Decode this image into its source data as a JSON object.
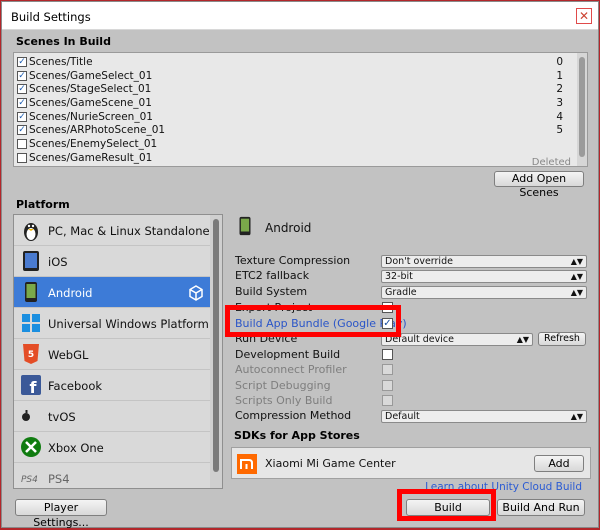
{
  "window": {
    "title": "Build Settings",
    "close_glyph": "✕"
  },
  "scenes": {
    "header": "Scenes In Build",
    "items": [
      {
        "name": "Scenes/Title",
        "checked": true,
        "index": "0"
      },
      {
        "name": "Scenes/GameSelect_01",
        "checked": true,
        "index": "1"
      },
      {
        "name": "Scenes/StageSelect_01",
        "checked": true,
        "index": "2"
      },
      {
        "name": "Scenes/GameScene_01",
        "checked": true,
        "index": "3"
      },
      {
        "name": "Scenes/NurieScreen_01",
        "checked": true,
        "index": "4"
      },
      {
        "name": "Scenes/ARPhotoScene_01",
        "checked": true,
        "index": "5"
      },
      {
        "name": "Scenes/EnemySelect_01",
        "checked": false,
        "index": ""
      },
      {
        "name": "Scenes/GameResult_01",
        "checked": false,
        "index": ""
      }
    ],
    "deleted_label": "Deleted",
    "add_open_scenes": "Add Open Scenes"
  },
  "platform": {
    "header": "Platform",
    "items": [
      {
        "label": "PC, Mac & Linux Standalone",
        "icon": "penguin-icon"
      },
      {
        "label": "iOS",
        "icon": "ios-device-icon"
      },
      {
        "label": "Android",
        "icon": "android-icon",
        "selected": true
      },
      {
        "label": "Universal Windows Platform",
        "icon": "windows-icon"
      },
      {
        "label": "WebGL",
        "icon": "html5-icon"
      },
      {
        "label": "Facebook",
        "icon": "facebook-icon"
      },
      {
        "label": "tvOS",
        "icon": "appletv-icon"
      },
      {
        "label": "Xbox One",
        "icon": "xbox-icon"
      },
      {
        "label": "PS4",
        "icon": "ps4-icon"
      }
    ]
  },
  "settings": {
    "platform_title": "Android",
    "texture_compression": {
      "label": "Texture Compression",
      "value": "Don't override"
    },
    "etc2_fallback": {
      "label": "ETC2 fallback",
      "value": "32-bit"
    },
    "build_system": {
      "label": "Build System",
      "value": "Gradle"
    },
    "export_project": {
      "label": "Export Project",
      "checked": false
    },
    "build_app_bundle": {
      "label": "Build App Bundle (Google Play)",
      "checked": true
    },
    "run_device": {
      "label": "Run Device",
      "value": "Default device",
      "refresh": "Refresh"
    },
    "development_build": {
      "label": "Development Build",
      "checked": false
    },
    "autoconnect_profiler": {
      "label": "Autoconnect Profiler"
    },
    "script_debugging": {
      "label": "Script Debugging"
    },
    "scripts_only_build": {
      "label": "Scripts Only Build"
    },
    "compression_method": {
      "label": "Compression Method",
      "value": "Default"
    }
  },
  "sdks": {
    "header": "SDKs for App Stores",
    "items": [
      {
        "name": "Xiaomi Mi Game Center",
        "button": "Add"
      }
    ]
  },
  "footer": {
    "cloud_link": "Learn about Unity Cloud Build",
    "player_settings": "Player Settings...",
    "build": "Build",
    "build_and_run": "Build And Run"
  },
  "colors": {
    "selection": "#3d7bd7",
    "highlight": "#ff0000",
    "link": "#2b5bd3"
  }
}
